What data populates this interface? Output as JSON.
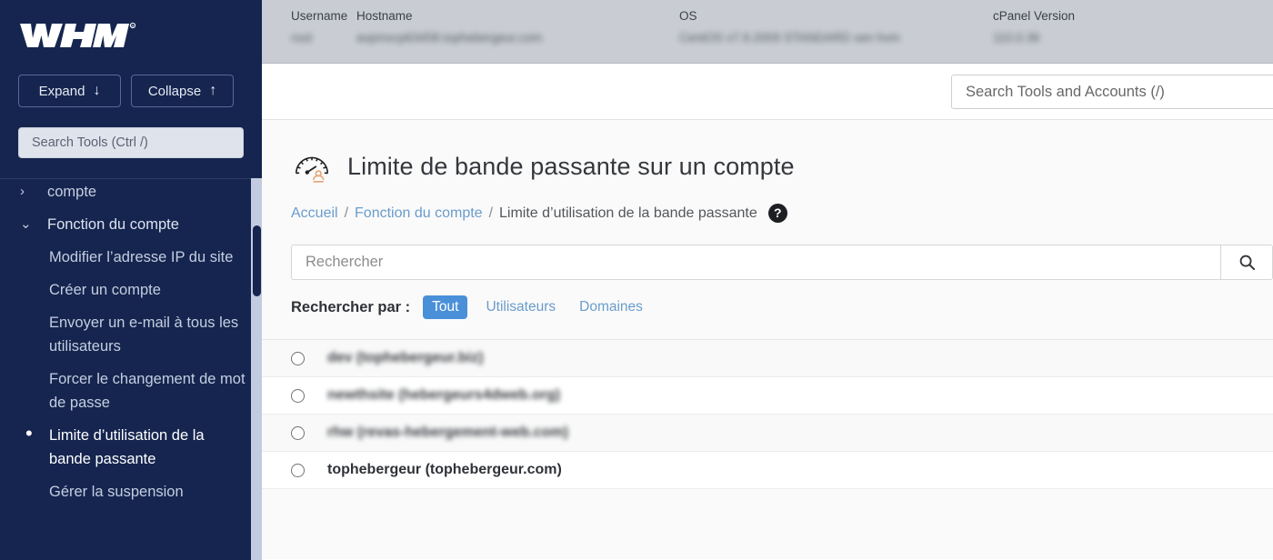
{
  "sidebar": {
    "logo_text": "WHM",
    "expand_label": "Expand",
    "expand_icon": "arrow-down-icon",
    "collapse_label": "Collapse",
    "collapse_icon": "arrow-up-icon",
    "search_placeholder": "Search Tools (Ctrl /)",
    "search_value": "",
    "items": [
      {
        "label": "compte",
        "icon": "chevron-right-icon",
        "type": "partial-group",
        "active": false
      },
      {
        "label": "Fonction du compte",
        "icon": "chevron-down-icon",
        "type": "group",
        "active": false
      },
      {
        "label": "Modifier l’adresse IP du site",
        "icon": "",
        "type": "child",
        "active": false
      },
      {
        "label": "Créer un compte",
        "icon": "",
        "type": "child",
        "active": false
      },
      {
        "label": "Envoyer un e-mail à tous les utilisateurs",
        "icon": "",
        "type": "child",
        "active": false
      },
      {
        "label": "Forcer le changement de mot de passe",
        "icon": "",
        "type": "child",
        "active": false
      },
      {
        "label": "Limite d’utilisation de la bande passante",
        "icon": "•",
        "type": "child",
        "active": true
      },
      {
        "label": "Gérer la suspension",
        "icon": "",
        "type": "child",
        "active": false
      }
    ]
  },
  "topbar": {
    "columns": [
      {
        "label": "Username",
        "value": "root",
        "masked": true
      },
      {
        "label": "Hostname",
        "value": "avpmxcp63458.tophebergeur.com",
        "masked": true
      },
      {
        "label": "OS",
        "value": "CentOS v7.9.2009 STANDARD xen hvm",
        "masked": true
      },
      {
        "label": "cPanel Version",
        "value": "110.0.36",
        "masked": true
      }
    ]
  },
  "global_search": {
    "placeholder": "Search Tools and Accounts (/)",
    "value": ""
  },
  "page": {
    "icon": "bandwidth-gauge-icon",
    "title": "Limite de bande passante sur un compte",
    "breadcrumb": {
      "home": "Accueil",
      "parent": "Fonction du compte",
      "current": "Limite d’utilisation de la bande passante",
      "separator": "/",
      "help_icon": "help-circle-icon",
      "help_glyph": "?"
    }
  },
  "filter": {
    "placeholder": "Rechercher",
    "value": "",
    "submit_icon": "search-icon",
    "searchby_label": "Rechercher par :",
    "options": [
      {
        "label": "Tout",
        "active": true
      },
      {
        "label": "Utilisateurs",
        "active": false
      },
      {
        "label": "Domaines",
        "active": false
      }
    ]
  },
  "accounts": [
    {
      "label": "dev (tophebergeur.biz)",
      "masked": true,
      "selected": false
    },
    {
      "label": "newthsite (hebergeurs4dweb.org)",
      "masked": true,
      "selected": false
    },
    {
      "label": "rhw (revas-hebergement-web.com)",
      "masked": true,
      "selected": false
    },
    {
      "label": "tophebergeur (tophebergeur.com)",
      "masked": false,
      "selected": false
    }
  ],
  "colors": {
    "sidebar_bg": "#15254f",
    "accent_blue": "#4a90d9",
    "link_blue": "#6a9ccb",
    "topbar_bg": "#c9ccd3",
    "content_bg": "#fafafa",
    "row_alt": "#f9f9f9",
    "icon_orange": "#e8a87c"
  }
}
